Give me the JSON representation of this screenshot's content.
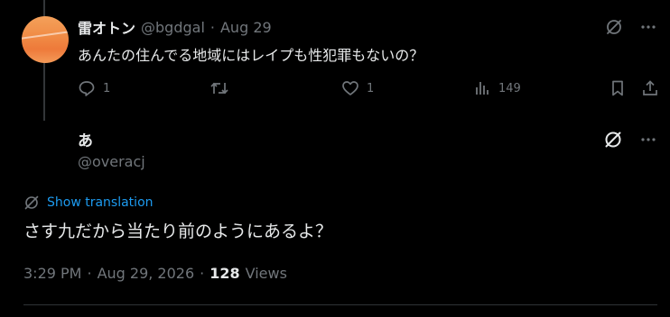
{
  "reply": {
    "display_name": "雷オトン",
    "handle": "@bgdgal",
    "separator": "·",
    "date": "Aug 29",
    "text": "あんたの住んでる地域にはレイプも性犯罪もないの？",
    "replies": "1",
    "retweets": "",
    "likes": "1",
    "views": "149"
  },
  "quote": {
    "display_name": "あ",
    "handle": "@overacj"
  },
  "translation": {
    "label": "Show translation"
  },
  "main_tweet": {
    "text": "さす九だから当たり前のようにあるよ？",
    "time": "3:29 PM",
    "separator1": "·",
    "date": "Aug 29, 2026",
    "separator2": "·",
    "views_count": "128",
    "views_label": "Views"
  },
  "colors": {
    "background": "#000000",
    "text_primary": "#e7e9ea",
    "text_secondary": "#71767b",
    "accent": "#1d9bf0",
    "divider": "#2f3336"
  },
  "icons": [
    "grok-slash-icon",
    "more-icon",
    "reply-icon",
    "retweet-icon",
    "like-icon",
    "views-icon",
    "bookmark-icon",
    "share-icon",
    "translate-icon"
  ]
}
